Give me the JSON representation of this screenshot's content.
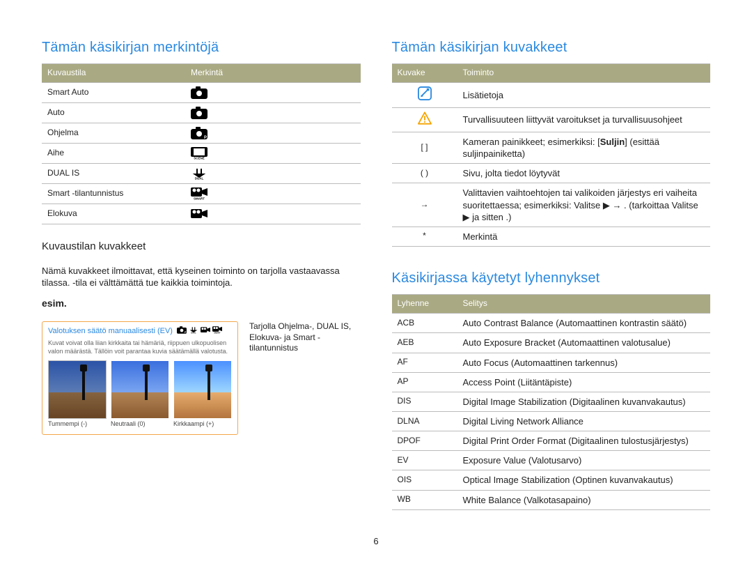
{
  "page_number": "6",
  "left": {
    "heading": "Tämän käsikirjan merkintöjä",
    "table1": {
      "head": [
        "Kuvaustila",
        "Merkintä"
      ],
      "rows": [
        {
          "mode": "Smart Auto",
          "icon": "camera-smart"
        },
        {
          "mode": "Auto",
          "icon": "camera"
        },
        {
          "mode": "Ohjelma",
          "icon": "camera-p"
        },
        {
          "mode": "Aihe",
          "icon": "scene"
        },
        {
          "mode": "DUAL IS",
          "icon": "dual"
        },
        {
          "mode": "Smart -tilantunnistus",
          "icon": "movie-smart"
        },
        {
          "mode": "Elokuva",
          "icon": "movie"
        }
      ]
    },
    "sub_heading": "Kuvaustilan kuvakkeet",
    "sub_text": "Nämä kuvakkeet ilmoittavat, että kyseinen toiminto on tarjolla vastaavassa tilassa.        -tila ei välttämättä tue kaikkia toimintoja.",
    "example_label": "esim.",
    "example": {
      "title": "Valotuksen säätö manuaalisesti (EV)",
      "desc": "Kuvat voivat olla liian kirkkaita tai hämäriä, riippuen ulkopuolisen valon määrästä. Tällöin voit parantaa kuvia säätämällä valotusta.",
      "thumbs": [
        "Tummempi (-)",
        "Neutraali (0)",
        "Kirkkaampi (+)"
      ]
    },
    "example_caption": "Tarjolla Ohjelma-, DUAL IS, Elokuva- ja Smart -tilantunnistus"
  },
  "right": {
    "heading1": "Tämän käsikirjan kuvakkeet",
    "table2": {
      "head": [
        "Kuvake",
        "Toiminto"
      ],
      "rows": [
        {
          "sym_mode": "note-icon",
          "text": "Lisätietoja"
        },
        {
          "sym_mode": "warning-icon",
          "text": "Turvallisuuteen liittyvät varoitukset ja turvallisuusohjeet"
        },
        {
          "sym": "[ ]",
          "text_html": "Kameran painikkeet; esimerkiksi: [<b>Suljin</b>] (esittää suljinpainiketta)"
        },
        {
          "sym": "( )",
          "text": "Sivu, jolta tiedot löytyvät"
        },
        {
          "sym": "→",
          "text": "Valittavien vaihtoehtojen tai valikoiden järjestys eri vaiheita suoritettaessa; esimerkiksi: Valitse ▶ →     . (tarkoittaa Valitse ▶ ja sitten     .)"
        },
        {
          "sym": "*",
          "text": "Merkintä"
        }
      ]
    },
    "heading2": "Käsikirjassa käytetyt lyhennykset",
    "table3": {
      "head": [
        "Lyhenne",
        "Selitys"
      ],
      "rows": [
        {
          "abbr": "ACB",
          "def": "Auto Contrast Balance (Automaattinen kontrastin säätö)"
        },
        {
          "abbr": "AEB",
          "def": "Auto Exposure Bracket (Automaattinen valotusalue)"
        },
        {
          "abbr": "AF",
          "def": "Auto Focus (Automaattinen tarkennus)"
        },
        {
          "abbr": "AP",
          "def": "Access Point (Liitäntäpiste)"
        },
        {
          "abbr": "DIS",
          "def": "Digital Image Stabilization (Digitaalinen kuvanvakautus)"
        },
        {
          "abbr": "DLNA",
          "def": "Digital Living Network Alliance"
        },
        {
          "abbr": "DPOF",
          "def": "Digital Print Order Format (Digitaalinen tulostusjärjestys)"
        },
        {
          "abbr": "EV",
          "def": "Exposure Value (Valotusarvo)"
        },
        {
          "abbr": "OIS",
          "def": "Optical Image Stabilization (Optinen kuvanvakautus)"
        },
        {
          "abbr": "WB",
          "def": "White Balance (Valkotasapaino)"
        }
      ]
    }
  }
}
